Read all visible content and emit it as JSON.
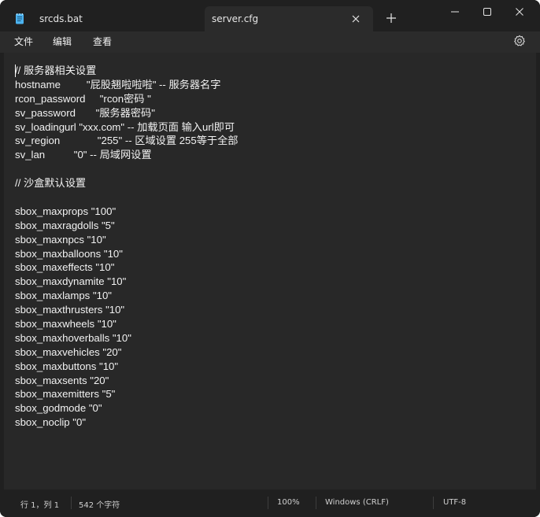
{
  "tabs": [
    {
      "label": "srcds.bat",
      "active": false,
      "icon": "notepad-file-icon"
    },
    {
      "label": "server.cfg",
      "active": true,
      "icon": "none"
    }
  ],
  "icons": {
    "tab_close": "close-icon",
    "new_tab": "plus-icon",
    "minimize": "minimize-icon",
    "maximize": "maximize-icon",
    "close": "close-icon",
    "settings": "gear-icon"
  },
  "menu": {
    "file": "文件",
    "edit": "编辑",
    "view": "查看"
  },
  "editor": {
    "lines": [
      "// 服务器相关设置",
      "hostname         \"屁股翘啦啦啦\" -- 服务器名字",
      "rcon_password     \"rcon密码 \"",
      "sv_password       \"服务器密码\"",
      "sv_loadingurl \"xxx.com\" -- 加载页面 输入url即可",
      "sv_region             \"255\" -- 区域设置 255等于全部",
      "sv_lan          \"0\" -- 局域网设置",
      "",
      "// 沙盒默认设置",
      "",
      "sbox_maxprops \"100\"",
      "sbox_maxragdolls \"5\"",
      "sbox_maxnpcs \"10\"",
      "sbox_maxballoons \"10\"",
      "sbox_maxeffects \"10\"",
      "sbox_maxdynamite \"10\"",
      "sbox_maxlamps \"10\"",
      "sbox_maxthrusters \"10\"",
      "sbox_maxwheels \"10\"",
      "sbox_maxhoverballs \"10\"",
      "sbox_maxvehicles \"20\"",
      "sbox_maxbuttons \"10\"",
      "sbox_maxsents \"20\"",
      "sbox_maxemitters \"5\"",
      "sbox_godmode \"0\"",
      "sbox_noclip \"0\""
    ]
  },
  "status": {
    "position": "行 1，列 1",
    "char_count": "542 个字符",
    "zoom": "100%",
    "line_ending": "Windows (CRLF)",
    "encoding": "UTF-8"
  },
  "colors": {
    "titlebar": "#202020",
    "active_tab": "#2b2b2b",
    "editor_bg": "#282828",
    "text": "#f2f2f2",
    "notepad_icon": "#4cb3f0"
  }
}
